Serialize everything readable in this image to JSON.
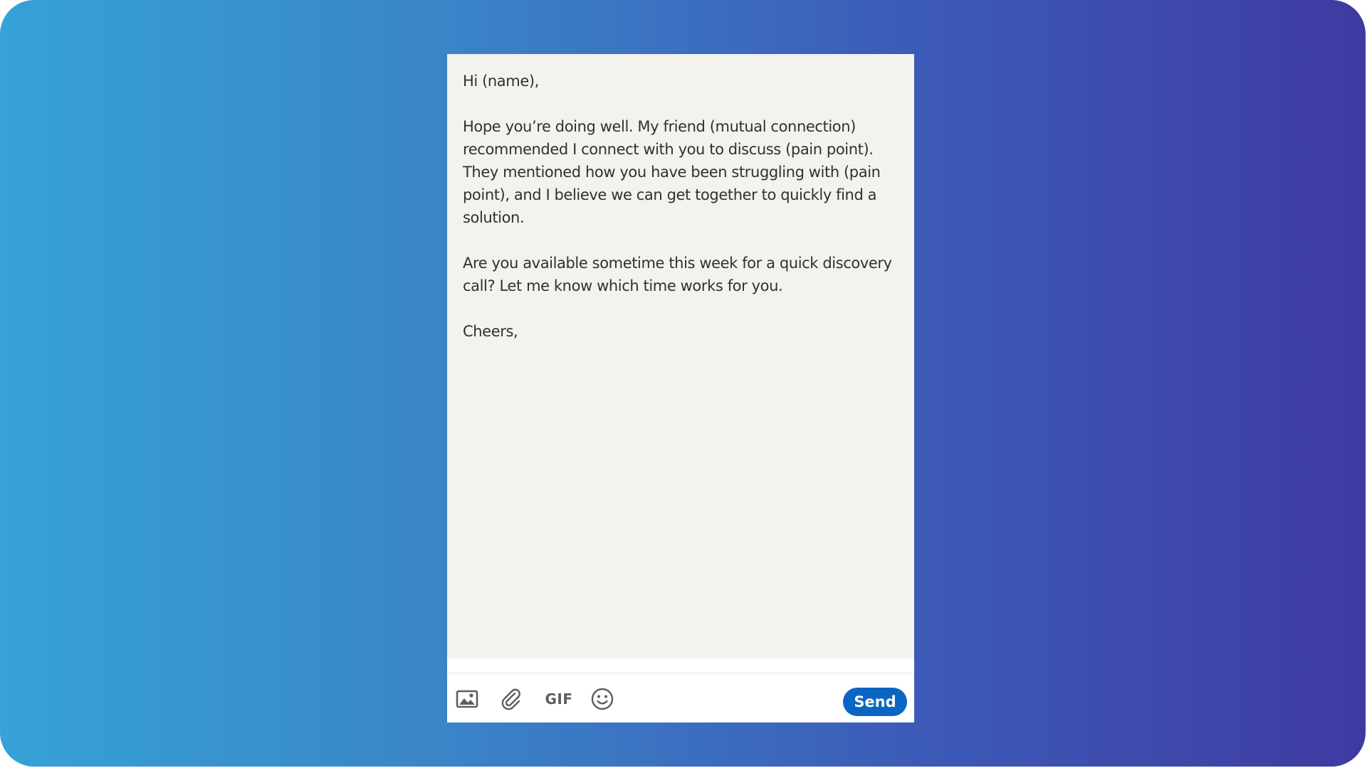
{
  "message": {
    "greeting": "Hi (name),",
    "paragraph_1": "Hope you’re doing well. My friend (mutual connection) recommended I connect with you to discuss (pain point). They mentioned how you have been struggling with (pain point), and I believe we can get together to quickly find a solution.",
    "paragraph_2": "Are you available sometime this week for a quick discovery call? Let me know which time works for you.",
    "signoff": "Cheers,"
  },
  "toolbar": {
    "icons": [
      "image-icon",
      "paperclip-icon",
      "gif-icon",
      "emoji-icon"
    ],
    "gif_label": "GIF",
    "send_label": "Send",
    "send_color": "#0a66c2"
  },
  "colors": {
    "gradient_start": "#36a2d6",
    "gradient_end": "#3f3aa2",
    "message_background": "#f3f2ef"
  }
}
